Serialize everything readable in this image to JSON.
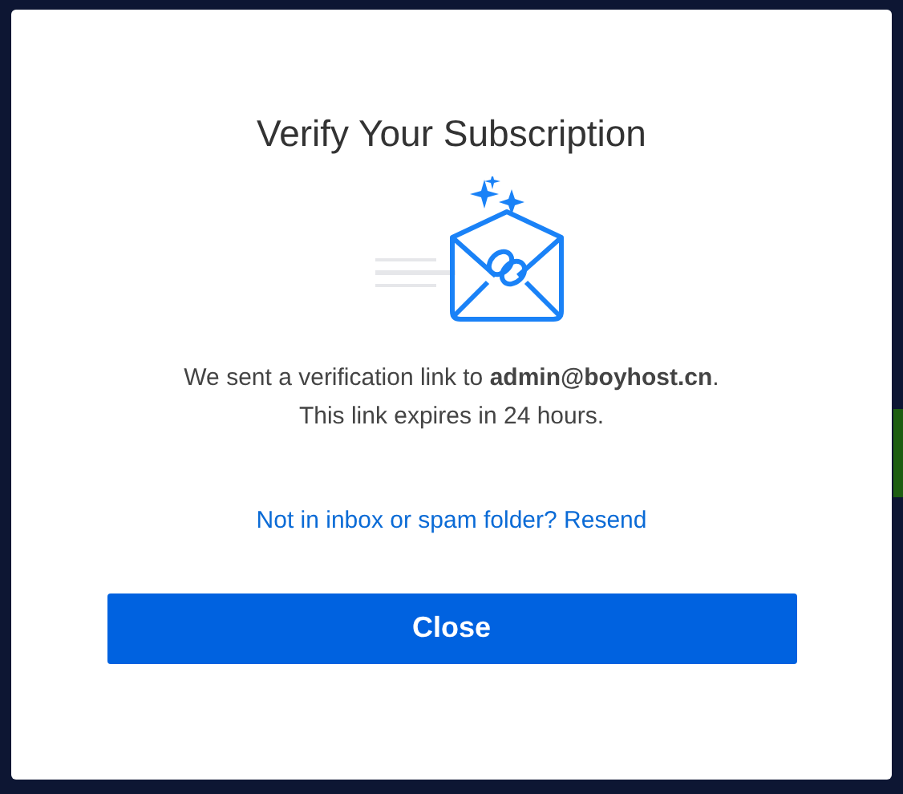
{
  "dialog": {
    "title": "Verify Your Subscription",
    "message_lines": [
      "We sent a verification link to **admin@boyhost.cn**.",
      "This link expires in 24 hours."
    ],
    "resend_link": "Not in inbox or spam folder? Resend",
    "close_button": "Close"
  }
}
